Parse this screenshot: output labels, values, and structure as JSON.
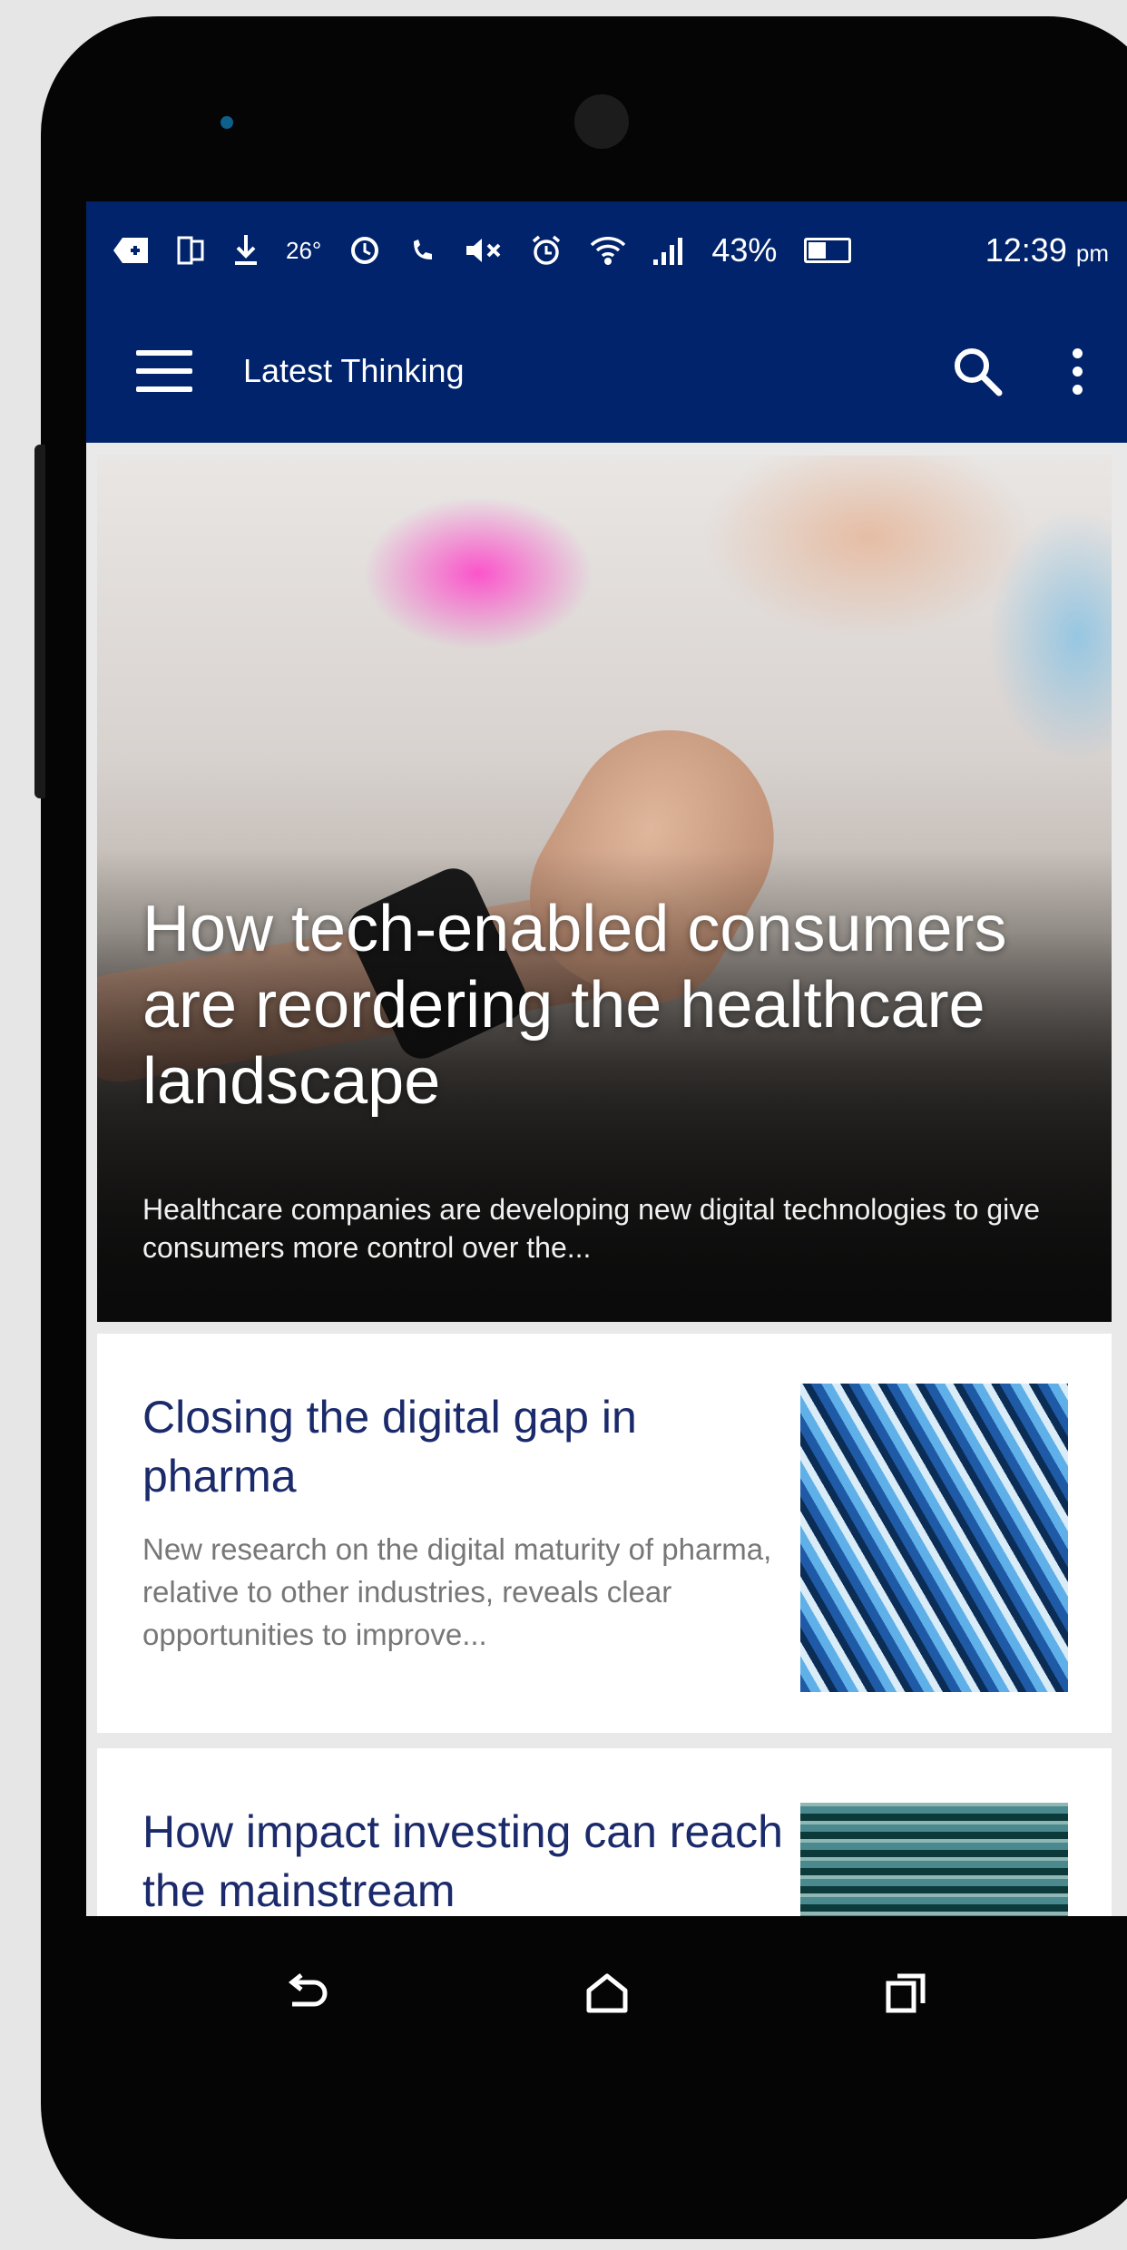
{
  "status_bar": {
    "temperature": "26°",
    "battery_percent": "43%",
    "time": "12:39",
    "time_suffix": "pm"
  },
  "app_bar": {
    "title": "Latest Thinking"
  },
  "featured": {
    "title": "How tech-enabled consumers are reordering the healthcare landscape",
    "summary": "Healthcare companies are developing new digital technologies to give consumers more control over the..."
  },
  "articles": [
    {
      "title": "Closing the digital gap in pharma",
      "summary": "New research on the digital maturity of pharma, relative to other industries, reveals clear opportunities to improve..."
    },
    {
      "title": "How impact investing can reach the mainstream",
      "summary": ""
    }
  ],
  "colors": {
    "primary": "#00236b",
    "card_title": "#1b2a6b",
    "card_summary": "#777777"
  }
}
